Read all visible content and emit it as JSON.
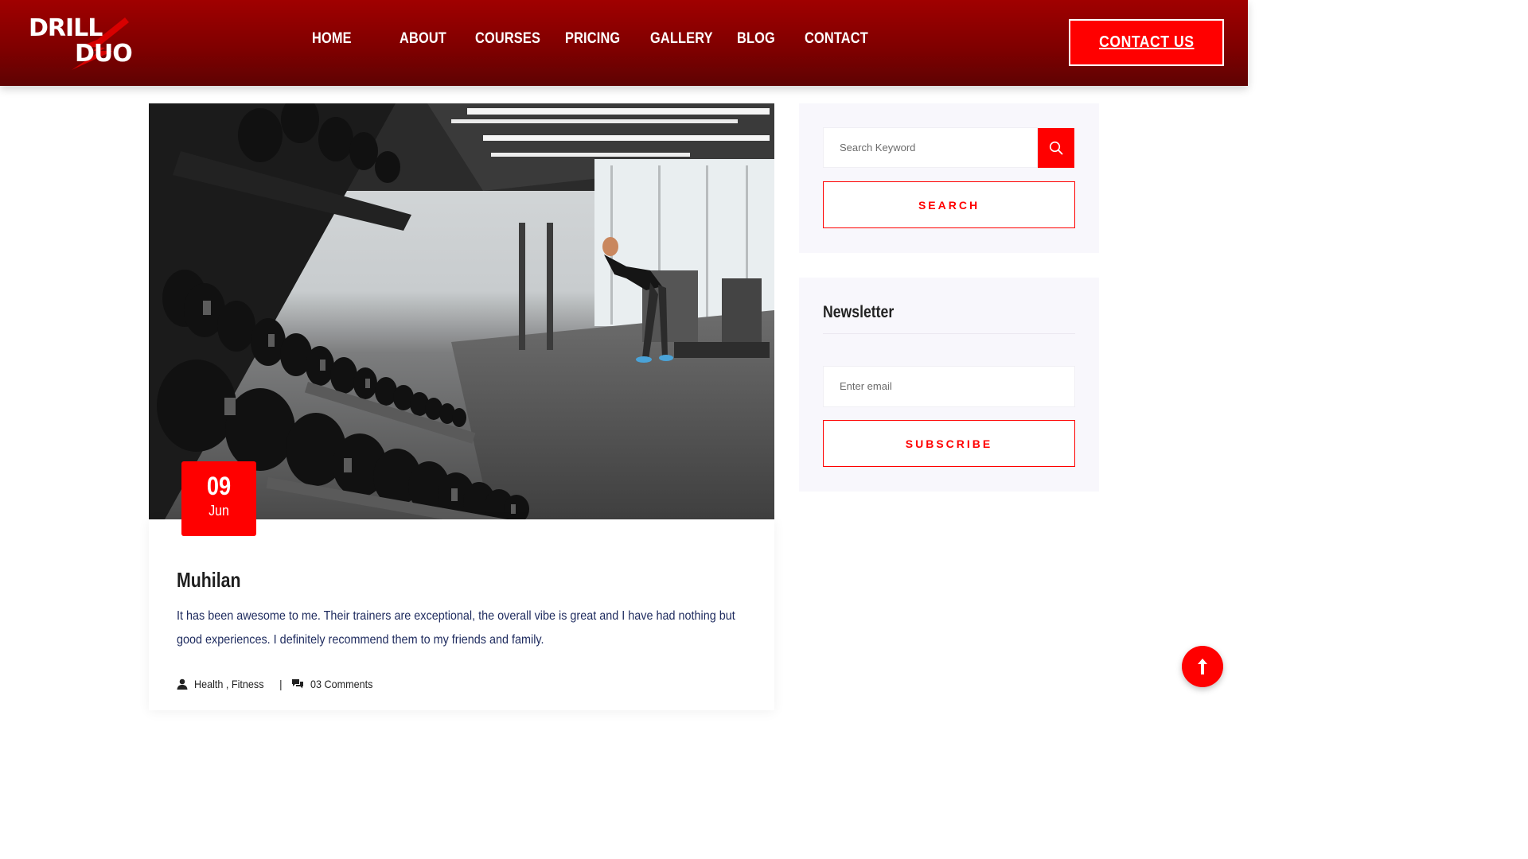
{
  "brand": {
    "logo_line1": "DRILL",
    "logo_line2": "DUO"
  },
  "nav": {
    "items": [
      {
        "label": "HOME"
      },
      {
        "label": "ABOUT"
      },
      {
        "label": "COURSES"
      },
      {
        "label": "PRICING"
      },
      {
        "label": "GALLERY"
      },
      {
        "label": "BLOG"
      },
      {
        "label": "CONTACT"
      }
    ],
    "cta_label": "CONTACT US"
  },
  "post": {
    "date_day": "09",
    "date_month": "Jun",
    "title": "Muhilan",
    "text_line1": "It has been awesome to me. Their trainers are exceptional, the overall vibe is great and I have had nothing but",
    "text_line2": "good experiences. I definitely recommend them to my friends and family.",
    "categories": "Health , Fitness",
    "separator": "|",
    "comments": "03 Comments"
  },
  "sidebar": {
    "search": {
      "placeholder": "Search Keyword",
      "button_label": "SEARCH"
    },
    "newsletter": {
      "title": "Newsletter",
      "email_placeholder": "Enter email",
      "button_label": "SUBSCRIBE"
    }
  },
  "colors": {
    "brand_red": "#ff0000",
    "header_dark_red": "#7d0000",
    "text_navy": "#1d2a5e",
    "widget_bg": "#f8f7fc"
  },
  "icons": {
    "search": "search-icon",
    "user": "user-icon",
    "comments": "comments-icon",
    "scroll_top": "arrow-up-icon"
  }
}
